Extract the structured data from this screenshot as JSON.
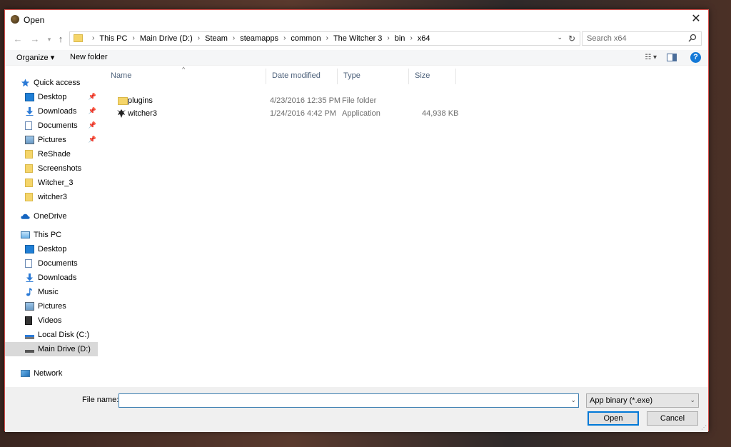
{
  "window": {
    "title": "Open",
    "close_glyph": "✕"
  },
  "nav_buttons": {
    "back": "←",
    "forward": "→",
    "recent": "▾",
    "up": "↑"
  },
  "address": {
    "crumbs": [
      "This PC",
      "Main Drive (D:)",
      "Steam",
      "steamapps",
      "common",
      "The Witcher 3",
      "bin",
      "x64"
    ],
    "separator": "›",
    "dropdown_glyph": "⌄",
    "refresh_glyph": "↻"
  },
  "search": {
    "placeholder": "Search x64"
  },
  "toolbar": {
    "organize_label": "Organize ▾",
    "new_folder_label": "New folder",
    "view_glyph": "☷ ▾",
    "help_glyph": "?"
  },
  "sidebar": {
    "quick_access": "Quick access",
    "quick_items": [
      {
        "label": "Desktop",
        "icon": "desktop-icon",
        "pinned": true
      },
      {
        "label": "Downloads",
        "icon": "downloads-icon",
        "pinned": true
      },
      {
        "label": "Documents",
        "icon": "documents-icon",
        "pinned": true
      },
      {
        "label": "Pictures",
        "icon": "pictures-icon",
        "pinned": true
      },
      {
        "label": "ReShade",
        "icon": "folder-icon",
        "pinned": false
      },
      {
        "label": "Screenshots",
        "icon": "folder-icon",
        "pinned": false
      },
      {
        "label": "Witcher_3",
        "icon": "folder-icon",
        "pinned": false
      },
      {
        "label": "witcher3",
        "icon": "folder-icon",
        "pinned": false
      }
    ],
    "onedrive": "OneDrive",
    "this_pc": "This PC",
    "pc_items": [
      {
        "label": "Desktop",
        "icon": "desktop-icon"
      },
      {
        "label": "Documents",
        "icon": "documents-icon"
      },
      {
        "label": "Downloads",
        "icon": "downloads-icon"
      },
      {
        "label": "Music",
        "icon": "music-icon"
      },
      {
        "label": "Pictures",
        "icon": "pictures-icon"
      },
      {
        "label": "Videos",
        "icon": "videos-icon"
      },
      {
        "label": "Local Disk (C:)",
        "icon": "drive-c-icon"
      },
      {
        "label": "Main Drive (D:)",
        "icon": "drive-d-icon",
        "selected": true
      }
    ],
    "network": "Network",
    "pin_glyph": "📌"
  },
  "columns": {
    "name": "Name",
    "date": "Date modified",
    "type": "Type",
    "size": "Size",
    "sort_glyph": "^"
  },
  "files": [
    {
      "name": "plugins",
      "date": "4/23/2016 12:35 PM",
      "type": "File folder",
      "size": "",
      "icon": "folder-icon"
    },
    {
      "name": "witcher3",
      "date": "1/24/2016 4:42 PM",
      "type": "Application",
      "size": "44,938 KB",
      "icon": "witcher-app-icon"
    }
  ],
  "bottom": {
    "file_name_label": "File name:",
    "file_name_value": "",
    "filter_value": "App binary (*.exe)",
    "open_label": "Open",
    "cancel_label": "Cancel",
    "dropdown_glyph": "⌄"
  },
  "colors": {
    "accent": "#0078d7",
    "folder": "#f5d56a",
    "header_text": "#4c607a",
    "selected_bg": "#d9d9d9"
  }
}
